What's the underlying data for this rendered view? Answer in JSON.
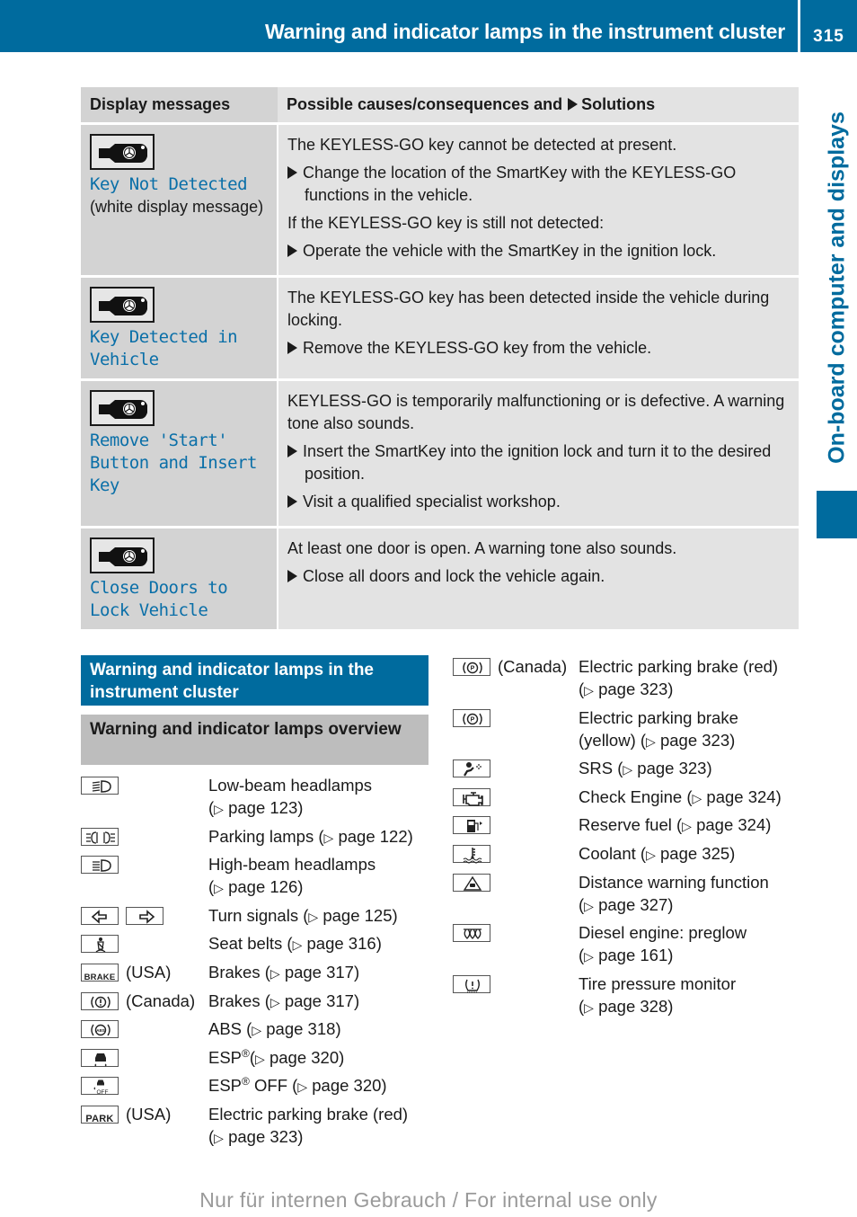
{
  "header": {
    "title": "Warning and indicator lamps in the instrument cluster",
    "page_number": "315"
  },
  "side_tab": {
    "label": "On-board computer and displays"
  },
  "messages_table": {
    "columns": [
      "Display messages",
      "Possible causes/consequences and",
      "Solutions"
    ],
    "rows": [
      {
        "icon": "smartkey-icon",
        "message": "Key Not Detected",
        "note": "(white display message)",
        "blocks": [
          {
            "type": "para",
            "text": "The KEYLESS-GO key cannot be detected at present."
          },
          {
            "type": "bullet",
            "text": "Change the location of the SmartKey with the KEYLESS-GO functions in the vehicle."
          },
          {
            "type": "para",
            "text": "If the KEYLESS-GO key is still not detected:"
          },
          {
            "type": "bullet",
            "text": "Operate the vehicle with the SmartKey in the ignition lock."
          }
        ]
      },
      {
        "icon": "smartkey-icon",
        "message": "Key Detected in Vehicle",
        "note": "",
        "blocks": [
          {
            "type": "para",
            "text": "The KEYLESS-GO key has been detected inside the vehicle during locking."
          },
          {
            "type": "bullet",
            "text": "Remove the KEYLESS-GO key from the vehicle."
          }
        ]
      },
      {
        "icon": "smartkey-icon",
        "message": "Remove 'Start' Button and Insert Key",
        "note": "",
        "blocks": [
          {
            "type": "para",
            "text": "KEYLESS-GO is temporarily malfunctioning or is defective. A warning tone also sounds."
          },
          {
            "type": "bullet",
            "text": "Insert the SmartKey into the ignition lock and turn it to the desired position."
          },
          {
            "type": "bullet",
            "text": "Visit a qualified specialist workshop."
          }
        ]
      },
      {
        "icon": "smartkey-icon",
        "message": "Close Doors to Lock Vehicle",
        "note": "",
        "blocks": [
          {
            "type": "para",
            "text": "At least one door is open. A warning tone also sounds."
          },
          {
            "type": "bullet",
            "text": "Close all doors and lock the vehicle again."
          }
        ]
      }
    ]
  },
  "section": {
    "heading": "Warning and indicator lamps in the instrument cluster",
    "subheading": "Warning and indicator lamps overview"
  },
  "lamps_left": [
    {
      "icon": "low-beam-icon",
      "region": "",
      "label": "Low-beam headlamps",
      "ref": "page 123",
      "wrap": true
    },
    {
      "icon": "parking-lamps-icon",
      "region": "",
      "label": "Parking lamps",
      "ref": "page 122",
      "wrap": false
    },
    {
      "icon": "high-beam-icon",
      "region": "",
      "label": "High-beam headlamps",
      "ref": "page 126",
      "wrap": true
    },
    {
      "icon": "turn-signals-icon",
      "region": "",
      "label": "Turn signals",
      "ref": "page 125",
      "wrap": false
    },
    {
      "icon": "seat-belt-icon",
      "region": "",
      "label": "Seat belts",
      "ref": "page 316",
      "wrap": false
    },
    {
      "icon": "brake-text-icon",
      "region": "(USA)",
      "label": "Brakes",
      "ref": "page 317",
      "wrap": false
    },
    {
      "icon": "brake-exclaim-icon",
      "region": "(Canada)",
      "label": "Brakes",
      "ref": "page 317",
      "wrap": false
    },
    {
      "icon": "abs-icon",
      "region": "",
      "label": "ABS",
      "ref": "page 318",
      "wrap": false
    },
    {
      "icon": "esp-icon",
      "region": "",
      "label": "ESP®",
      "ref": "page 320",
      "wrap": false
    },
    {
      "icon": "esp-off-icon",
      "region": "",
      "label": "ESP® OFF",
      "ref": "page 320",
      "wrap": false
    },
    {
      "icon": "park-text-icon",
      "region": "(USA)",
      "label": "Electric parking brake (red)",
      "ref": "page 323",
      "wrap": true
    }
  ],
  "lamps_right": [
    {
      "icon": "parking-brake-icon",
      "region": "(Canada)",
      "label": "Electric parking brake (red)",
      "ref": "page 323",
      "wrap": true
    },
    {
      "icon": "parking-brake-icon",
      "region": "",
      "label": "Electric parking brake (yellow)",
      "ref": "page 323",
      "wrap": false,
      "split": [
        "Electric parking brake",
        "(yellow)"
      ]
    },
    {
      "icon": "srs-airbag-icon",
      "region": "",
      "label": "SRS",
      "ref": "page 323",
      "wrap": false
    },
    {
      "icon": "check-engine-icon",
      "region": "",
      "label": "Check Engine",
      "ref": "page 324",
      "wrap": false
    },
    {
      "icon": "reserve-fuel-icon",
      "region": "",
      "label": "Reserve fuel",
      "ref": "page 324",
      "wrap": false
    },
    {
      "icon": "coolant-icon",
      "region": "",
      "label": "Coolant",
      "ref": "page 325",
      "wrap": false
    },
    {
      "icon": "distance-warning-icon",
      "region": "",
      "label": "Distance warning function",
      "ref": "page 327",
      "wrap": true
    },
    {
      "icon": "preglow-icon",
      "region": "",
      "label": "Diesel engine: preglow",
      "ref": "page 161",
      "wrap": true
    },
    {
      "icon": "tire-pressure-icon",
      "region": "",
      "label": "Tire pressure monitor",
      "ref": "page 328",
      "wrap": true
    }
  ],
  "footer": {
    "watermark": "Nur für internen Gebrauch / For internal use only"
  },
  "colors": {
    "brand_blue": "#006b9e",
    "message_text": "#0a6fa8",
    "header_gray": "#d3d3d3",
    "cell_gray": "#e3e3e3",
    "subheader_gray": "#bdbdbd"
  }
}
